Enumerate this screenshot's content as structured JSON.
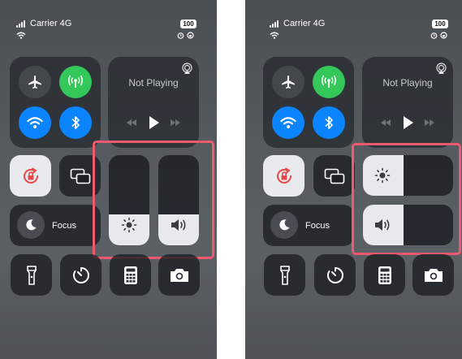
{
  "status_bar": {
    "carrier": "Carrier 4G",
    "battery": "100"
  },
  "media": {
    "title": "Not Playing"
  },
  "focus": {
    "label": "Focus"
  },
  "sliders": {
    "brightness_level": 0.34,
    "volume_level": 0.34,
    "horizontal_brightness_level": 0.45,
    "horizontal_volume_level": 0.45
  },
  "colors": {
    "highlight": "#ef5a6f",
    "cellular_active": "#34c759",
    "wifi_active": "#0a84ff",
    "bluetooth_active": "#0a84ff",
    "slider_fill": "#e7e9ec",
    "rotation_lock": "#e94848"
  },
  "icons": {
    "connectivity": [
      "airplane-icon",
      "cellular-antenna-icon",
      "wifi-icon",
      "bluetooth-icon"
    ],
    "controls": [
      "rotation-lock-icon",
      "screen-mirroring-icon",
      "moon-icon",
      "sun-icon",
      "speaker-icon"
    ],
    "shortcuts": [
      "flashlight-icon",
      "timer-icon",
      "calculator-icon",
      "camera-icon"
    ]
  }
}
